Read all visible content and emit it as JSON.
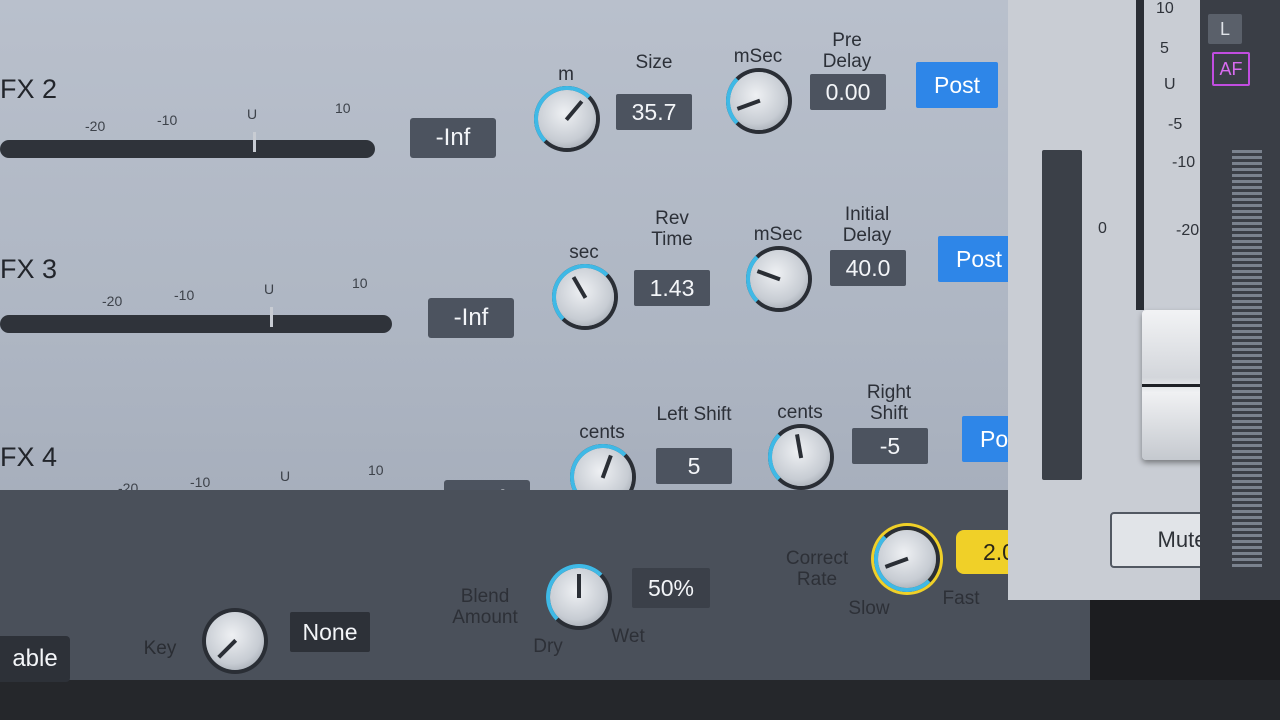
{
  "channels": [
    {
      "label": "FX 2",
      "level": "-Inf",
      "knob1_unit": "m",
      "param1_label": "Size",
      "param1_value": "35.7",
      "knob2_unit": "mSec",
      "param2_label": "Pre\nDelay",
      "param2_value": "0.00",
      "send": "Post"
    },
    {
      "label": "FX 3",
      "level": "-Inf",
      "knob1_unit": "sec",
      "param1_label": "Rev\nTime",
      "param1_value": "1.43",
      "knob2_unit": "mSec",
      "param2_label": "Initial\nDelay",
      "param2_value": "40.0",
      "send": "Post"
    },
    {
      "label": "FX 4",
      "level": "-Inf",
      "knob1_unit": "cents",
      "param1_label": "Left Shift",
      "param1_value": "5",
      "knob2_unit": "cents",
      "param2_label": "Right\nShift",
      "param2_value": "-5",
      "send": "Post"
    }
  ],
  "meter_scale": [
    "-20",
    "-10",
    "U",
    "10"
  ],
  "bottom": {
    "enable_label": "able",
    "key_label": "Key",
    "key_value": "None",
    "blend_label": "Blend\nAmount",
    "blend_value": "50%",
    "dry_label": "Dry",
    "wet_label": "Wet",
    "correct_label": "Correct\nRate",
    "correct_value": "2.0",
    "slow_label": "Slow",
    "fast_label": "Fast"
  },
  "fader": {
    "scale": [
      "10",
      "5",
      "U",
      "-5",
      "-10",
      "-20"
    ],
    "meter_zero": "0",
    "mute_label": "Mute"
  },
  "sidebar": {
    "l_label": "L",
    "af_label": "AF"
  },
  "colors": {
    "accent_blue": "#2e86e8",
    "knob_ring": "#3fb9e6",
    "correct_yellow": "#f0d028"
  }
}
